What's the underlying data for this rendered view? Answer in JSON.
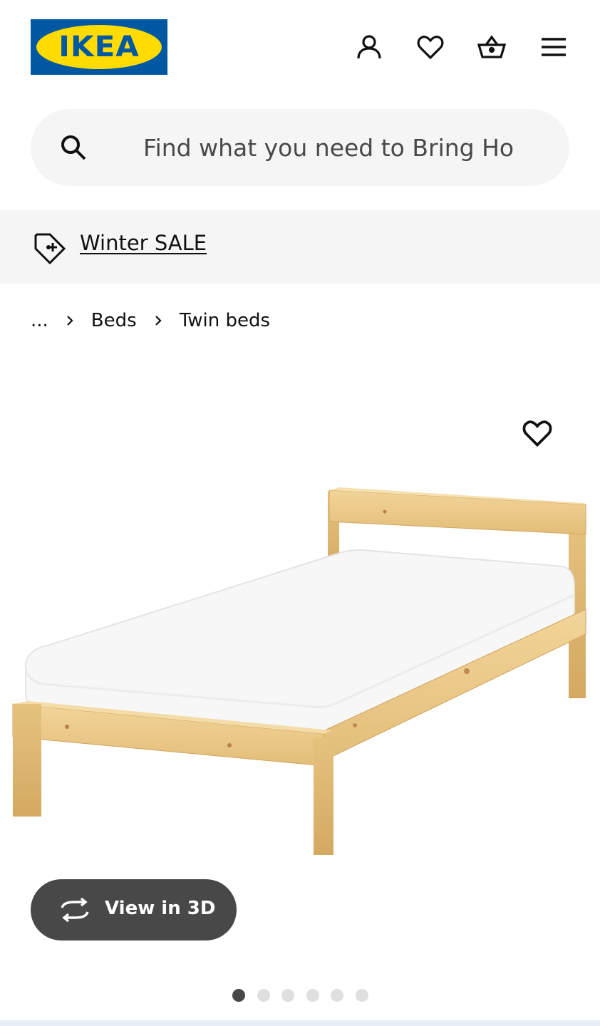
{
  "header": {
    "logo_text": "IKEA",
    "icons": [
      "user-icon",
      "heart-icon",
      "basket-icon",
      "menu-icon"
    ]
  },
  "search": {
    "placeholder": "Find what you need to Bring Hor"
  },
  "promo": {
    "label": "Winter SALE",
    "icon": "price-tag-icon"
  },
  "breadcrumb": {
    "items": [
      "...",
      "Beds",
      "Twin beds"
    ]
  },
  "product": {
    "image_icon": "bed-product-image",
    "favorite_icon": "heart-icon"
  },
  "view3d": {
    "label": "View in 3D",
    "icon": "rotate-icon"
  },
  "carousel": {
    "total": 6,
    "active_index": 0
  },
  "colors": {
    "brand_blue": "#0058a3",
    "brand_yellow": "#ffdb00",
    "button_dark": "#484848",
    "surface": "#f5f5f5"
  }
}
